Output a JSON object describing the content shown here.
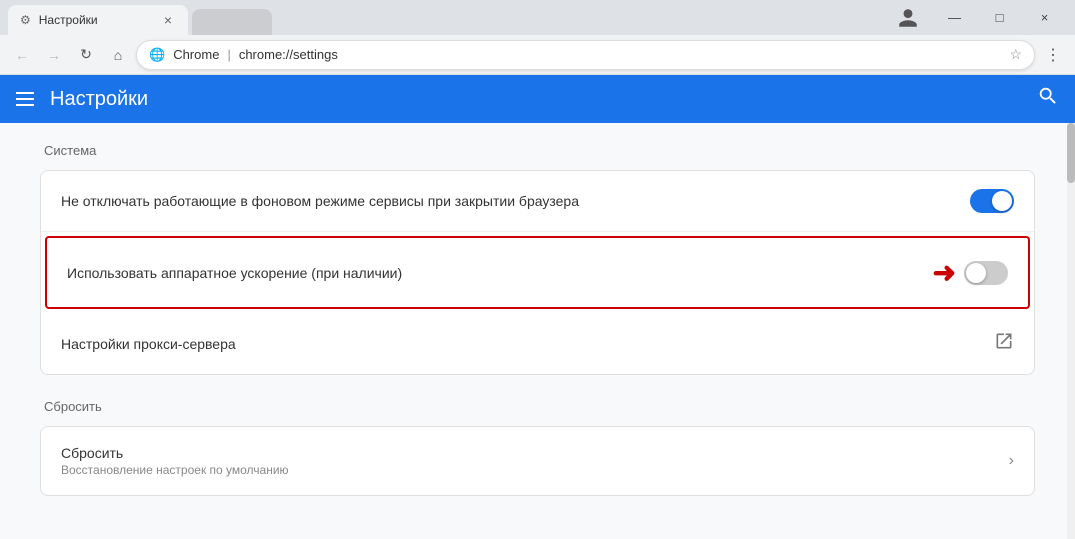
{
  "titlebar": {
    "tab_title": "Настройки",
    "tab_close": "×",
    "btn_minimize": "—",
    "btn_maximize": "□",
    "btn_close": "×"
  },
  "addressbar": {
    "back_arrow": "←",
    "forward_arrow": "→",
    "refresh": "↻",
    "home": "⌂",
    "brand_name": "Chrome",
    "separator": "|",
    "url_path": "chrome://settings",
    "star": "☆",
    "menu": "⋮"
  },
  "header": {
    "title": "Настройки",
    "search_icon": "🔍"
  },
  "sections": [
    {
      "id": "system",
      "title": "Система",
      "rows": [
        {
          "id": "background-services",
          "text": "Не отключать работающие в фоновом режиме сервисы при закрытии браузера",
          "toggle_on": true
        },
        {
          "id": "hardware-acceleration",
          "text": "Использовать аппаратное ускорение (при наличии)",
          "toggle_on": false,
          "highlighted": true,
          "has_arrow": true
        },
        {
          "id": "proxy-settings",
          "text": "Настройки прокси-сервера",
          "is_link": true
        }
      ]
    },
    {
      "id": "reset",
      "title": "Сбросить",
      "rows": [
        {
          "id": "reset-settings",
          "title": "Сбросить",
          "subtitle": "Восстановление настроек по умолчанию"
        }
      ]
    }
  ]
}
